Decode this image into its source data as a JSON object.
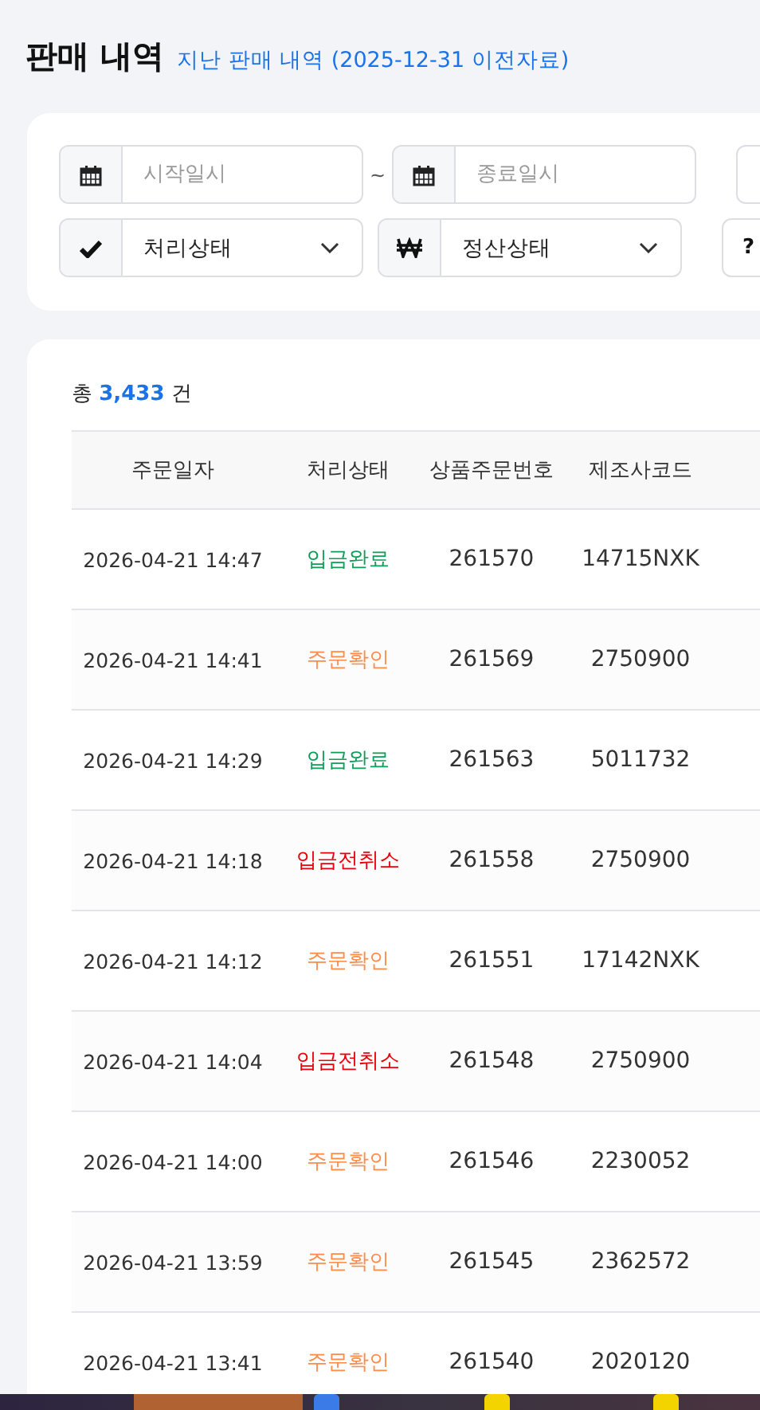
{
  "header": {
    "title": "판매 내역",
    "link": "지난 판매 내역 (2025-12-31 이전자료)"
  },
  "filters": {
    "start_date": {
      "placeholder": "시작일시"
    },
    "separator": "~",
    "end_date": {
      "placeholder": "종료일시"
    },
    "process_status": {
      "value": "처리상태"
    },
    "settlement_status": {
      "value": "정산상태"
    },
    "help_button": "?"
  },
  "summary": {
    "prefix": "총",
    "count": "3,433",
    "suffix": "건"
  },
  "table": {
    "columns": [
      "주문일자",
      "처리상태",
      "상품주문번호",
      "제조사코드"
    ],
    "rows": [
      {
        "date": "2026-04-21 14:47",
        "status": "입금완료",
        "color": "#0f9d58",
        "order_no": "261570",
        "maker_code": "14715NXK"
      },
      {
        "date": "2026-04-21 14:41",
        "status": "주문확인",
        "color": "#ff8c4a",
        "order_no": "261569",
        "maker_code": "2750900"
      },
      {
        "date": "2026-04-21 14:29",
        "status": "입금완료",
        "color": "#0f9d58",
        "order_no": "261563",
        "maker_code": "5011732"
      },
      {
        "date": "2026-04-21 14:18",
        "status": "입금전취소",
        "color": "#e8000b",
        "order_no": "261558",
        "maker_code": "2750900"
      },
      {
        "date": "2026-04-21 14:12",
        "status": "주문확인",
        "color": "#ff8c4a",
        "order_no": "261551",
        "maker_code": "17142NXK"
      },
      {
        "date": "2026-04-21 14:04",
        "status": "입금전취소",
        "color": "#e8000b",
        "order_no": "261548",
        "maker_code": "2750900"
      },
      {
        "date": "2026-04-21 14:00",
        "status": "주문확인",
        "color": "#ff8c4a",
        "order_no": "261546",
        "maker_code": "2230052"
      },
      {
        "date": "2026-04-21 13:59",
        "status": "주문확인",
        "color": "#ff8c4a",
        "order_no": "261545",
        "maker_code": "2362572"
      },
      {
        "date": "2026-04-21 13:41",
        "status": "주문확인",
        "color": "#ff8c4a",
        "order_no": "261540",
        "maker_code": "2020120"
      }
    ]
  }
}
